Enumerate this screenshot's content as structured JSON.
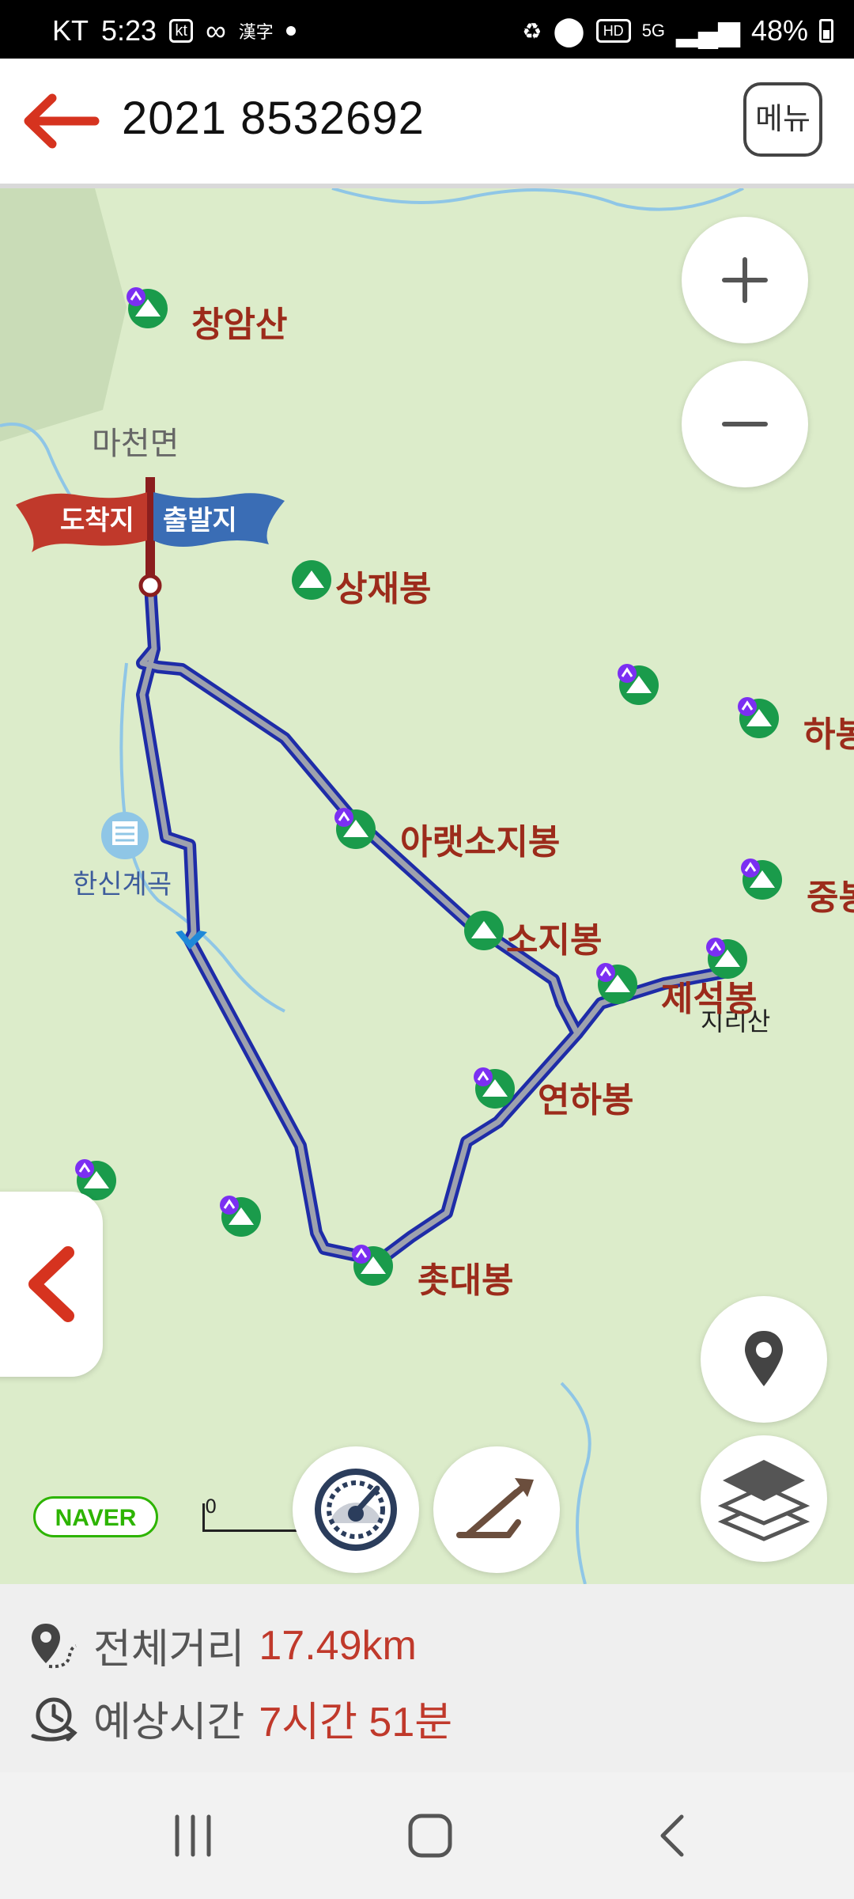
{
  "status_bar": {
    "carrier": "KT",
    "time": "5:23",
    "network": "5G",
    "battery": "48%"
  },
  "top_bar": {
    "title": "2021 8532692",
    "menu_label": "메뉴"
  },
  "map": {
    "flag_end_label": "도착지",
    "flag_start_label": "출발지",
    "village_label": "마천면",
    "valley_label": "한신계곡",
    "peaks": [
      "창암산",
      "상재봉",
      "하봉",
      "아랫소지봉",
      "중봉",
      "소지봉",
      "제석봉",
      "연하봉",
      "촛대봉"
    ],
    "sub_label": "지리산",
    "attribution": "NAVER",
    "scale_zero": "0"
  },
  "route_info": {
    "distance_label": "전체거리",
    "distance_value": "17.49km",
    "time_label": "예상시간",
    "time_value": "7시간 51분"
  },
  "colors": {
    "accent": "#c0392b",
    "route": "#1e2ca8",
    "map_bg": "#dcecca",
    "peak_green": "#1a9b4b",
    "peak_label": "#9c2b1b"
  }
}
